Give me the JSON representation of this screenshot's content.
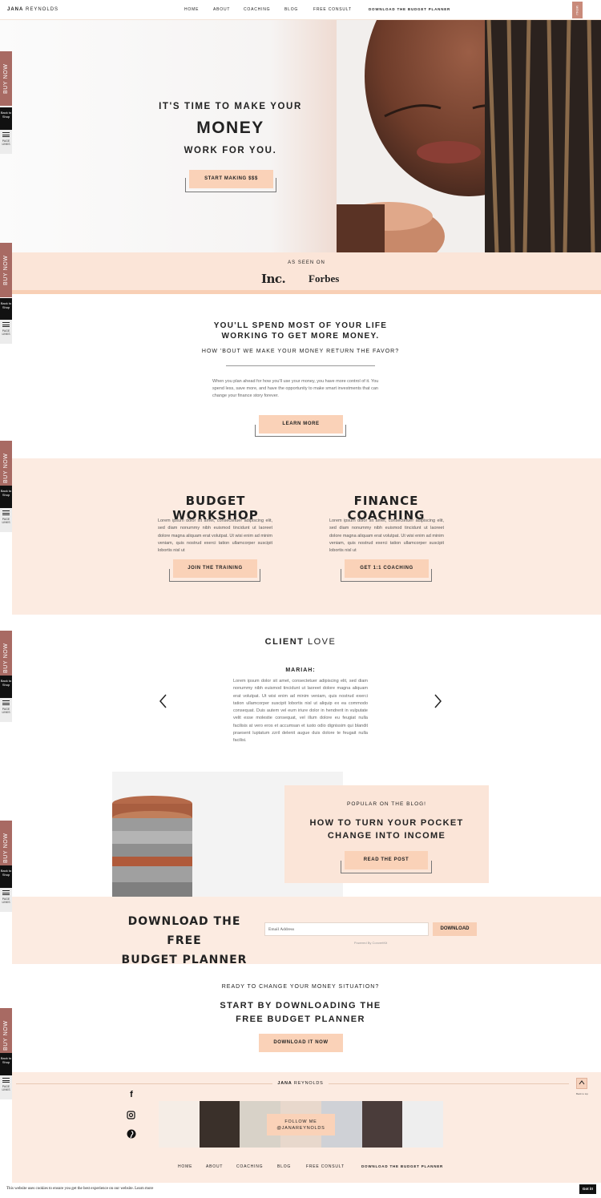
{
  "header": {
    "logo_first": "JANA",
    "logo_last": "REYNOLDS",
    "nav": [
      "HOME",
      "ABOUT",
      "COACHING",
      "BLOG",
      "FREE CONSULT"
    ],
    "nav_download": "DOWNLOAD THE BUDGET PLANNER",
    "menu_label": "MENU"
  },
  "side": {
    "buy_now": "BUY NOW",
    "back_to_shop": "Back to Shop",
    "page_links": "PAGE LINKS"
  },
  "hero": {
    "line1": "IT'S TIME TO MAKE YOUR",
    "line2": "MONEY",
    "line3": "WORK FOR YOU.",
    "button": "START MAKING $$$"
  },
  "press": {
    "label": "AS SEEN ON",
    "logos": [
      "Inc.",
      "Forbes"
    ]
  },
  "intro": {
    "heading_line1": "YOU'LL SPEND MOST OF YOUR LIFE",
    "heading_line2": "WORKING TO GET MORE MONEY.",
    "subheading": "HOW 'BOUT WE MAKE YOUR MONEY RETURN THE FAVOR?",
    "body": "When you plan ahead for how you'll use your money, you have more control of it. You spend less, save more, and have the opportunity to make smart investments that can change your finance story forever.",
    "button": "LEARN MORE"
  },
  "services": [
    {
      "title": "BUDGET WORKSHOP",
      "body": "Lorem ipsum dolor sit amet, consectetuer adipiscing elit, sed diam nonummy nibh euismod tincidunt ut laoreet dolore magna aliquam erat volutpat. Ut wisi enim ad minim veniam, quis nostrud exerci tation ullamcorper suscipit lobortis nisl ut",
      "button": "JOIN THE TRAINING"
    },
    {
      "title": "FINANCE COACHING",
      "body": "Lorem ipsum dolor sit amet, consectetuer adipiscing elit, sed diam nonummy nibh euismod tincidunt ut laoreet dolore magna aliquam erat volutpat. Ut wisi enim ad minim veniam, quis nostrud exerci tation ullamcorper suscipit lobortis nisl ut",
      "button": "GET 1:1 COACHING"
    }
  ],
  "testimonial": {
    "heading_bold": "CLIENT",
    "heading_light": "LOVE",
    "name": "MARIAH:",
    "body": "Lorem ipsum dolor sit amet, consectetuer adipiscing elit, sed diam nonummy nibh euismod tincidunt ut laoreet dolore magna aliquam erat volutpat. Ut wisi enim ad minim veniam, quis nostrud exerci tation ullamcorper suscipit lobortis nisl ut aliquip ex ea commodo consequat. Duis autem vel eum iriure dolor in hendrerit in vulputate velit esse molestie consequat, vel illum dolore eu feugiat nulla facilisis at vero eros et accumsan et iusto odio dignissim qui blandit praesent luptatum zzril delenit augue duis dolore te feugait nulla facilisi.",
    "prev_icon": "chevron-left-icon",
    "next_icon": "chevron-right-icon"
  },
  "blog": {
    "label": "POPULAR ON THE BLOG!",
    "title_line1": "HOW TO TURN YOUR POCKET",
    "title_line2": "CHANGE INTO INCOME",
    "button": "READ THE POST"
  },
  "optin": {
    "heading_line1": "DOWNLOAD THE FREE",
    "heading_line2": "BUDGET PLANNER",
    "email_placeholder": "Email Address",
    "button": "DOWNLOAD",
    "powered": "Powered By ConvertKit"
  },
  "cta": {
    "eyebrow": "READY TO CHANGE YOUR MONEY SITUATION?",
    "heading_line1": "START BY DOWNLOADING THE",
    "heading_line2": "FREE BUDGET PLANNER",
    "button": "DOWNLOAD IT NOW"
  },
  "footer": {
    "logo_first": "JANA",
    "logo_last": "REYNOLDS",
    "back_to_top": "Back to top",
    "social_icons": [
      "facebook-icon",
      "instagram-icon",
      "pinterest-icon"
    ],
    "follow_line1": "FOLLOW ME",
    "follow_line2": "@JANAREYNOLDS",
    "nav": [
      "HOME",
      "ABOUT",
      "COACHING",
      "BLOG",
      "FREE CONSULT"
    ],
    "nav_download": "DOWNLOAD THE BUDGET PLANNER"
  },
  "cookie": {
    "text": "This website uses cookies to ensure you get the best experience on our website.",
    "link": "Learn more",
    "button": "Got it!"
  },
  "colors": {
    "accent_peach": "#fad2b8",
    "section_bg": "#fcebe1",
    "buy_now_bg": "#a86a63"
  }
}
